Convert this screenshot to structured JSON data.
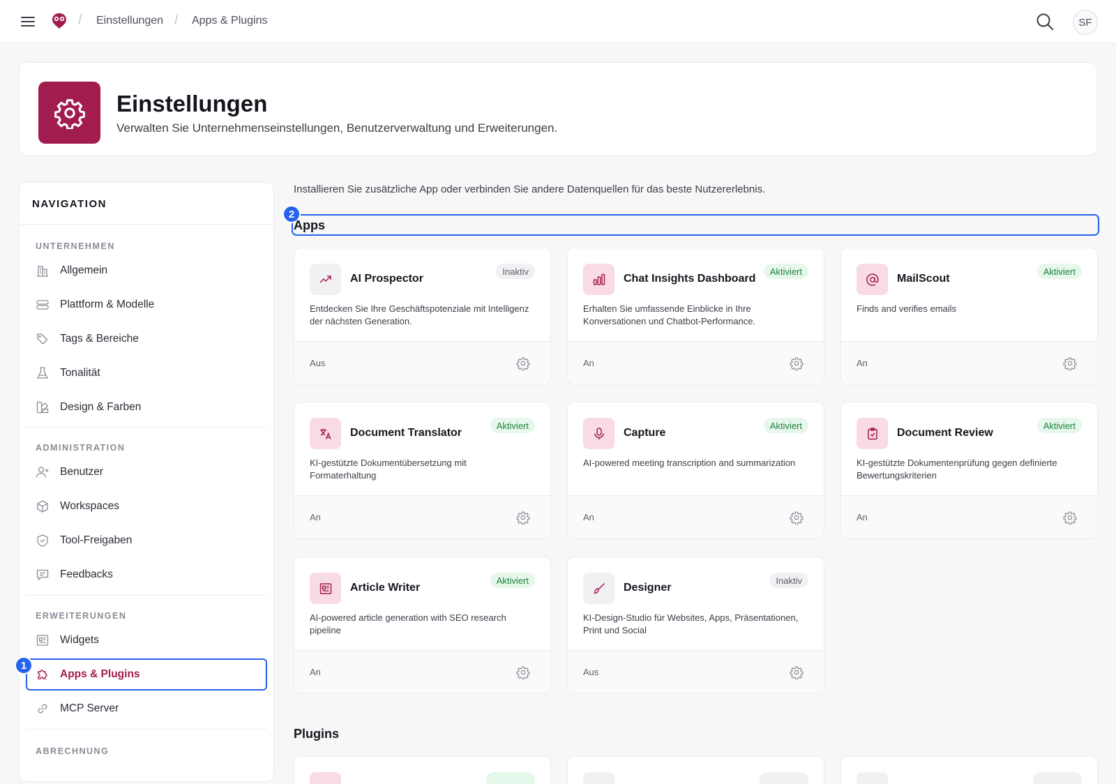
{
  "topbar": {
    "breadcrumbs": [
      "Einstellungen",
      "Apps & Plugins"
    ],
    "avatar_initials": "SF"
  },
  "header": {
    "title": "Einstellungen",
    "subtitle": "Verwalten Sie Unternehmenseinstellungen, Benutzerverwaltung und Erweiterungen."
  },
  "sidebar": {
    "title": "NAVIGATION",
    "sections": [
      {
        "label": "UNTERNEHMEN",
        "items": [
          "Allgemein",
          "Plattform & Modelle",
          "Tags & Bereiche",
          "Tonalität",
          "Design & Farben"
        ]
      },
      {
        "label": "ADMINISTRATION",
        "items": [
          "Benutzer",
          "Workspaces",
          "Tool-Freigaben",
          "Feedbacks"
        ]
      },
      {
        "label": "ERWEITERUNGEN",
        "items": [
          "Widgets",
          "Apps & Plugins",
          "MCP Server"
        ]
      },
      {
        "label": "ABRECHNUNG",
        "items": []
      }
    ],
    "active_item": "Apps & Plugins"
  },
  "markers": [
    "1",
    "2"
  ],
  "main": {
    "intro": "Installieren Sie zusätzliche App oder verbinden Sie andere Datenquellen für das beste Nutzererlebnis.",
    "apps_title": "Apps",
    "plugins_title": "Plugins",
    "apps": [
      {
        "name": "AI Prospector",
        "status": "Inaktiv",
        "active": false,
        "description": "Entdecken Sie Ihre Geschäftspotenziale mit Intelligenz der nächsten Generation.",
        "state": "Aus",
        "icon": "trend-up-icon"
      },
      {
        "name": "Chat Insights Dashboard",
        "status": "Aktiviert",
        "active": true,
        "description": "Erhalten Sie umfassende Einblicke in Ihre Konversationen und Chatbot-Performance.",
        "state": "An",
        "icon": "bar-chart-icon"
      },
      {
        "name": "MailScout",
        "status": "Aktiviert",
        "active": true,
        "description": "Finds and verifies emails",
        "state": "An",
        "icon": "at-sign-icon"
      },
      {
        "name": "Document Translator",
        "status": "Aktiviert",
        "active": true,
        "description": "KI-gestützte Dokumentübersetzung mit Formaterhaltung",
        "state": "An",
        "icon": "translate-icon"
      },
      {
        "name": "Capture",
        "status": "Aktiviert",
        "active": true,
        "description": "AI-powered meeting transcription and summarization",
        "state": "An",
        "icon": "microphone-icon"
      },
      {
        "name": "Document Review",
        "status": "Aktiviert",
        "active": true,
        "description": "KI-gestützte Dokumentenprüfung gegen definierte Bewertungskriterien",
        "state": "An",
        "icon": "clipboard-check-icon"
      },
      {
        "name": "Article Writer",
        "status": "Aktiviert",
        "active": true,
        "description": "AI-powered article generation with SEO research pipeline",
        "state": "An",
        "icon": "newspaper-icon"
      },
      {
        "name": "Designer",
        "status": "Inaktiv",
        "active": false,
        "description": "KI-Design-Studio für Websites, Apps, Präsentationen, Print und Social",
        "state": "Aus",
        "icon": "brush-icon"
      }
    ]
  },
  "colors": {
    "brand": "#a31c4f",
    "highlight": "#2563eb",
    "active_badge_bg": "#e6f7ec",
    "active_badge_text": "#1a7f3c",
    "app_icon_bg_active": "#f9dbe5",
    "app_icon_bg_inactive": "#f1f1f3"
  }
}
